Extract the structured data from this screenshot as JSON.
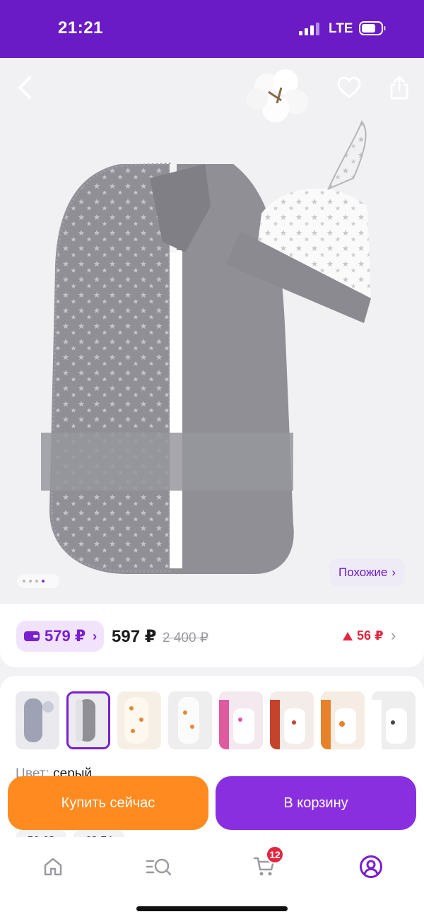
{
  "status_bar": {
    "time": "21:21",
    "network": "LTE"
  },
  "hero": {
    "icons": {
      "back": "chevron-left-icon",
      "favorite": "heart-icon",
      "share": "share-icon"
    },
    "image_count": 4,
    "active_image": 4,
    "similar_label": "Похожие",
    "similar_chevron": "›"
  },
  "price": {
    "wallet_price": "579 ₽",
    "wallet_chevron": "›",
    "main_price": "597 ₽",
    "old_price": "2 400 ₽",
    "points": "56 ₽",
    "points_chevron": "›"
  },
  "variants": {
    "color_label": "Цвет:",
    "color_value": "серый",
    "thumbnails": [
      "thumb-1",
      "thumb-2",
      "thumb-3",
      "thumb-4",
      "thumb-5",
      "thumb-6",
      "thumb-7",
      "thumb-8"
    ],
    "selected_thumbnail": 2,
    "sizes": [
      "56-68",
      "68-74"
    ]
  },
  "actions": {
    "buy_now": "Купить сейчас",
    "add_to_cart": "В корзину"
  },
  "bottom_nav": {
    "items": [
      "home-icon",
      "catalog-search-icon",
      "cart-icon",
      "profile-icon"
    ],
    "cart_badge": "12"
  },
  "colors": {
    "accent": "#6a1bc6",
    "buy_now": "#ff8a1f",
    "add_to_cart": "#8a2fe0",
    "points": "#e3263f"
  }
}
